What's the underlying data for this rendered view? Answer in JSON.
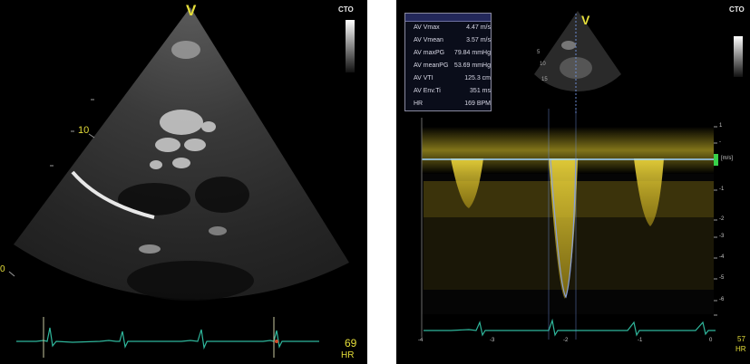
{
  "left": {
    "probe_marker": "V",
    "preset": "CTO",
    "depth_label": "10",
    "depth_label_2": "0",
    "hr_value": "69",
    "hr_unit": "HR"
  },
  "right": {
    "probe_marker": "V",
    "preset": "CTO",
    "scale_unit": "[m/s]",
    "hr_value": "57",
    "hr_unit": "HR",
    "measurements": [
      {
        "label": "AV Vmax",
        "value": "4.47 m/s"
      },
      {
        "label": "AV Vmean",
        "value": "3.57 m/s"
      },
      {
        "label": "AV maxPG",
        "value": "79.84 mmHg"
      },
      {
        "label": "AV meanPG",
        "value": "53.69 mmHg"
      },
      {
        "label": "AV VTI",
        "value": "125.3 cm"
      },
      {
        "label": "AV Env.Ti",
        "value": "351 ms"
      },
      {
        "label": "HR",
        "value": "169 BPM"
      }
    ],
    "velocity_scale": [
      "1",
      "-",
      "0",
      "-1",
      "-2",
      "-3",
      "-4",
      "-5",
      "-6"
    ],
    "time_scale": [
      "-4",
      "-3",
      "-2",
      "-1",
      "0"
    ],
    "mini_depth": [
      "5",
      "10",
      "15"
    ]
  },
  "colors": {
    "doppler_yellow": "#d8c22a",
    "ecg_teal": "#2fb79c",
    "baseline_blue": "#9fd4ff",
    "marker_green": "#38d14a"
  }
}
